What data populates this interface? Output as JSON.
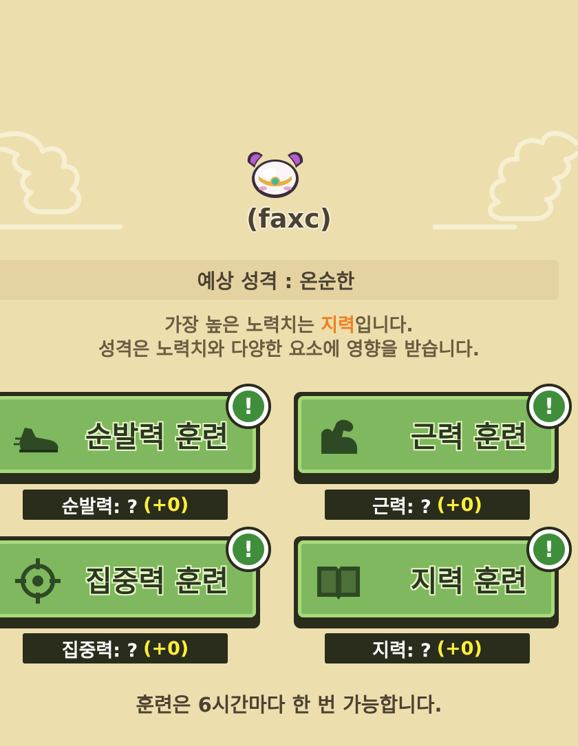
{
  "pet": {
    "name": "(faxc)"
  },
  "personality": {
    "label": "예상 성격 : 온순한"
  },
  "description": {
    "line1_prefix": "가장 높은 노력치는 ",
    "line1_highlight": "지력",
    "line1_suffix": "입니다.",
    "line2": "성격은 노력치와 다양한 요소에 영향을 받습니다."
  },
  "trainings": [
    {
      "label": "순발력 훈련",
      "icon": "shoe-icon",
      "stat_label": "순발력: ?",
      "stat_gain": "(+0)",
      "alert": "!"
    },
    {
      "label": "근력 훈련",
      "icon": "muscle-arm-icon",
      "stat_label": "근력: ?",
      "stat_gain": "(+0)",
      "alert": "!"
    },
    {
      "label": "집중력 훈련",
      "icon": "crosshair-icon",
      "stat_label": "집중력: ?",
      "stat_gain": "(+0)",
      "alert": "!"
    },
    {
      "label": "지력 훈련",
      "icon": "book-icon",
      "stat_label": "지력: ?",
      "stat_gain": "(+0)",
      "alert": "!"
    }
  ],
  "footer": {
    "note": "훈련은 6시간마다 한 번 가능합니다."
  },
  "colors": {
    "background": "#ecdfad",
    "button_green": "#7fb85e",
    "button_border": "#2a2c1c",
    "alert_green": "#3f8f3a",
    "highlight_orange": "#f07f20",
    "gain_yellow": "#ffef3a"
  }
}
